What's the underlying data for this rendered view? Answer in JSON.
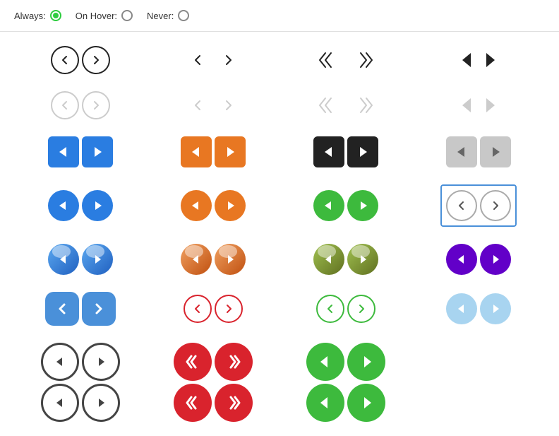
{
  "topbar": {
    "always_label": "Always:",
    "onhover_label": "On Hover:",
    "never_label": "Never:"
  },
  "colors": {
    "blue": "#2a7de1",
    "blue_light": "#5b9bd5",
    "blue_soft": "#7ab3e0",
    "orange": "#e87722",
    "black": "#222222",
    "gray_btn": "#c0c0c0",
    "green_bright": "#3dba3d",
    "green_dark": "#5a8a00",
    "green_medium": "#6ab04c",
    "purple": "#6200c8",
    "red": "#d9232d",
    "light_blue_pastel": "#a8d4f0"
  }
}
